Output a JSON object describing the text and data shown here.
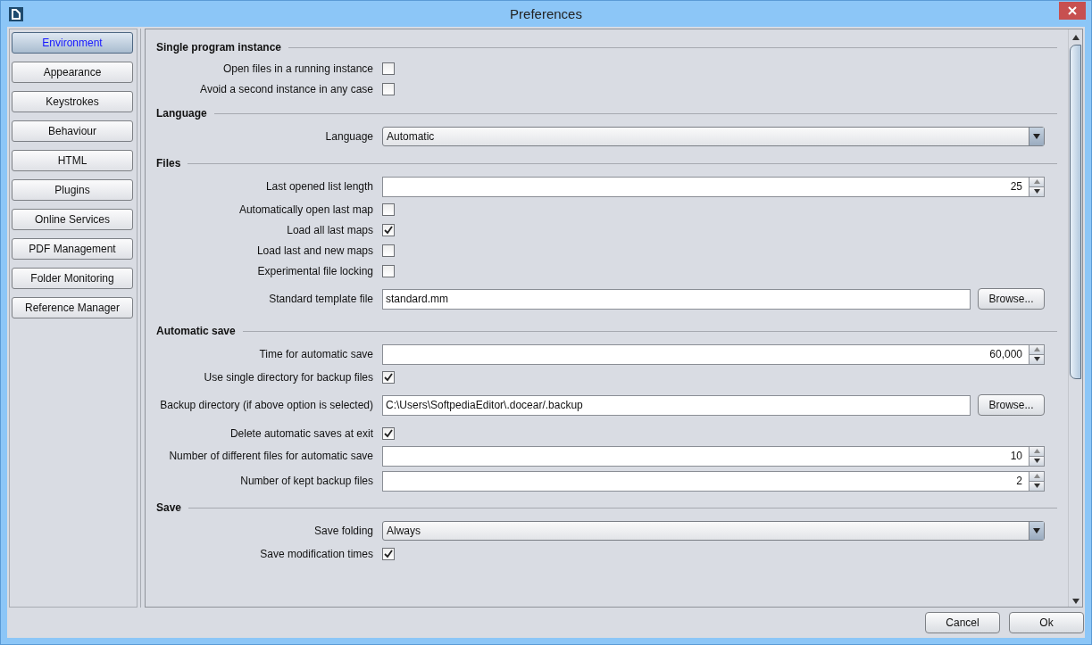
{
  "window": {
    "title": "Preferences"
  },
  "sidebar": {
    "items": [
      {
        "label": "Environment",
        "selected": true
      },
      {
        "label": "Appearance",
        "selected": false
      },
      {
        "label": "Keystrokes",
        "selected": false
      },
      {
        "label": "Behaviour",
        "selected": false
      },
      {
        "label": "HTML",
        "selected": false
      },
      {
        "label": "Plugins",
        "selected": false
      },
      {
        "label": "Online Services",
        "selected": false
      },
      {
        "label": "PDF Management",
        "selected": false
      },
      {
        "label": "Folder Monitoring",
        "selected": false
      },
      {
        "label": "Reference Manager",
        "selected": false
      }
    ]
  },
  "sections": [
    {
      "title": "Single program instance",
      "rows": [
        {
          "kind": "checkbox",
          "label": "Open files in a running instance",
          "checked": false
        },
        {
          "kind": "checkbox",
          "label": "Avoid a second instance in any case",
          "checked": false
        }
      ]
    },
    {
      "title": "Language",
      "rows": [
        {
          "kind": "dropdown",
          "label": "Language",
          "value": "Automatic"
        }
      ]
    },
    {
      "title": "Files",
      "rows": [
        {
          "kind": "spinner",
          "label": "Last opened list length",
          "value": "25"
        },
        {
          "kind": "checkbox",
          "label": "Automatically open last map",
          "checked": false
        },
        {
          "kind": "checkbox",
          "label": "Load all last maps",
          "checked": true
        },
        {
          "kind": "checkbox",
          "label": "Load last and new maps",
          "checked": false
        },
        {
          "kind": "checkbox",
          "label": "Experimental file locking",
          "checked": false
        },
        {
          "kind": "file",
          "label": "Standard template file",
          "value": "standard.mm",
          "button": "Browse..."
        }
      ]
    },
    {
      "title": "Automatic save",
      "rows": [
        {
          "kind": "spinner",
          "label": "Time for automatic save",
          "value": "60,000"
        },
        {
          "kind": "checkbox",
          "label": "Use single directory for backup files",
          "checked": true
        },
        {
          "kind": "file",
          "label": "Backup directory (if above option is selected)",
          "value": "C:\\Users\\SoftpediaEditor\\.docear/.backup",
          "button": "Browse..."
        },
        {
          "kind": "checkbox",
          "label": "Delete automatic saves at exit",
          "checked": true
        },
        {
          "kind": "spinner",
          "label": "Number of different files for automatic save",
          "value": "10"
        },
        {
          "kind": "spinner",
          "label": "Number of kept backup files",
          "value": "2"
        }
      ]
    },
    {
      "title": "Save",
      "rows": [
        {
          "kind": "dropdown",
          "label": "Save folding",
          "value": "Always"
        },
        {
          "kind": "checkbox",
          "label": "Save modification times",
          "checked": true
        }
      ]
    }
  ],
  "buttons": [
    "Cancel",
    "Ok"
  ]
}
